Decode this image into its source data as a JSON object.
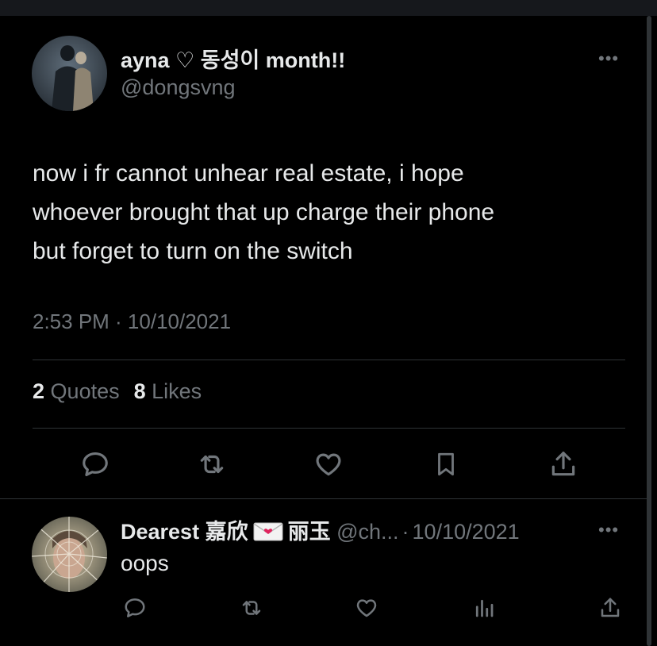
{
  "tweet": {
    "author_name": "ayna ♡ 동성이 month!!",
    "author_handle": "@dongsvng",
    "more_label": "•••",
    "text_lines": [
      "now i fr cannot unhear real estate, i hope",
      "whoever brought that up charge their phone",
      "but forget to turn on the switch"
    ],
    "timestamp": "2:53 PM · 10/10/2021",
    "quotes_count": "2",
    "quotes_label": "Quotes",
    "likes_count": "8",
    "likes_label": "Likes"
  },
  "actions": [
    "reply-icon",
    "retweet-icon",
    "like-icon",
    "bookmark-icon",
    "share-icon"
  ],
  "reply": {
    "author_name_part1": "Dearest 嘉欣",
    "author_name_part2": "丽玉",
    "author_handle": "@ch...",
    "separator": "·",
    "date": "10/10/2021",
    "more_label": "•••",
    "text": "oops",
    "actions": [
      "reply-icon",
      "retweet-icon",
      "like-icon",
      "views-icon",
      "share-icon"
    ]
  },
  "colors": {
    "background": "#000000",
    "text_primary": "#e7e9ea",
    "text_secondary": "#71767b",
    "divider": "#2f3336"
  }
}
